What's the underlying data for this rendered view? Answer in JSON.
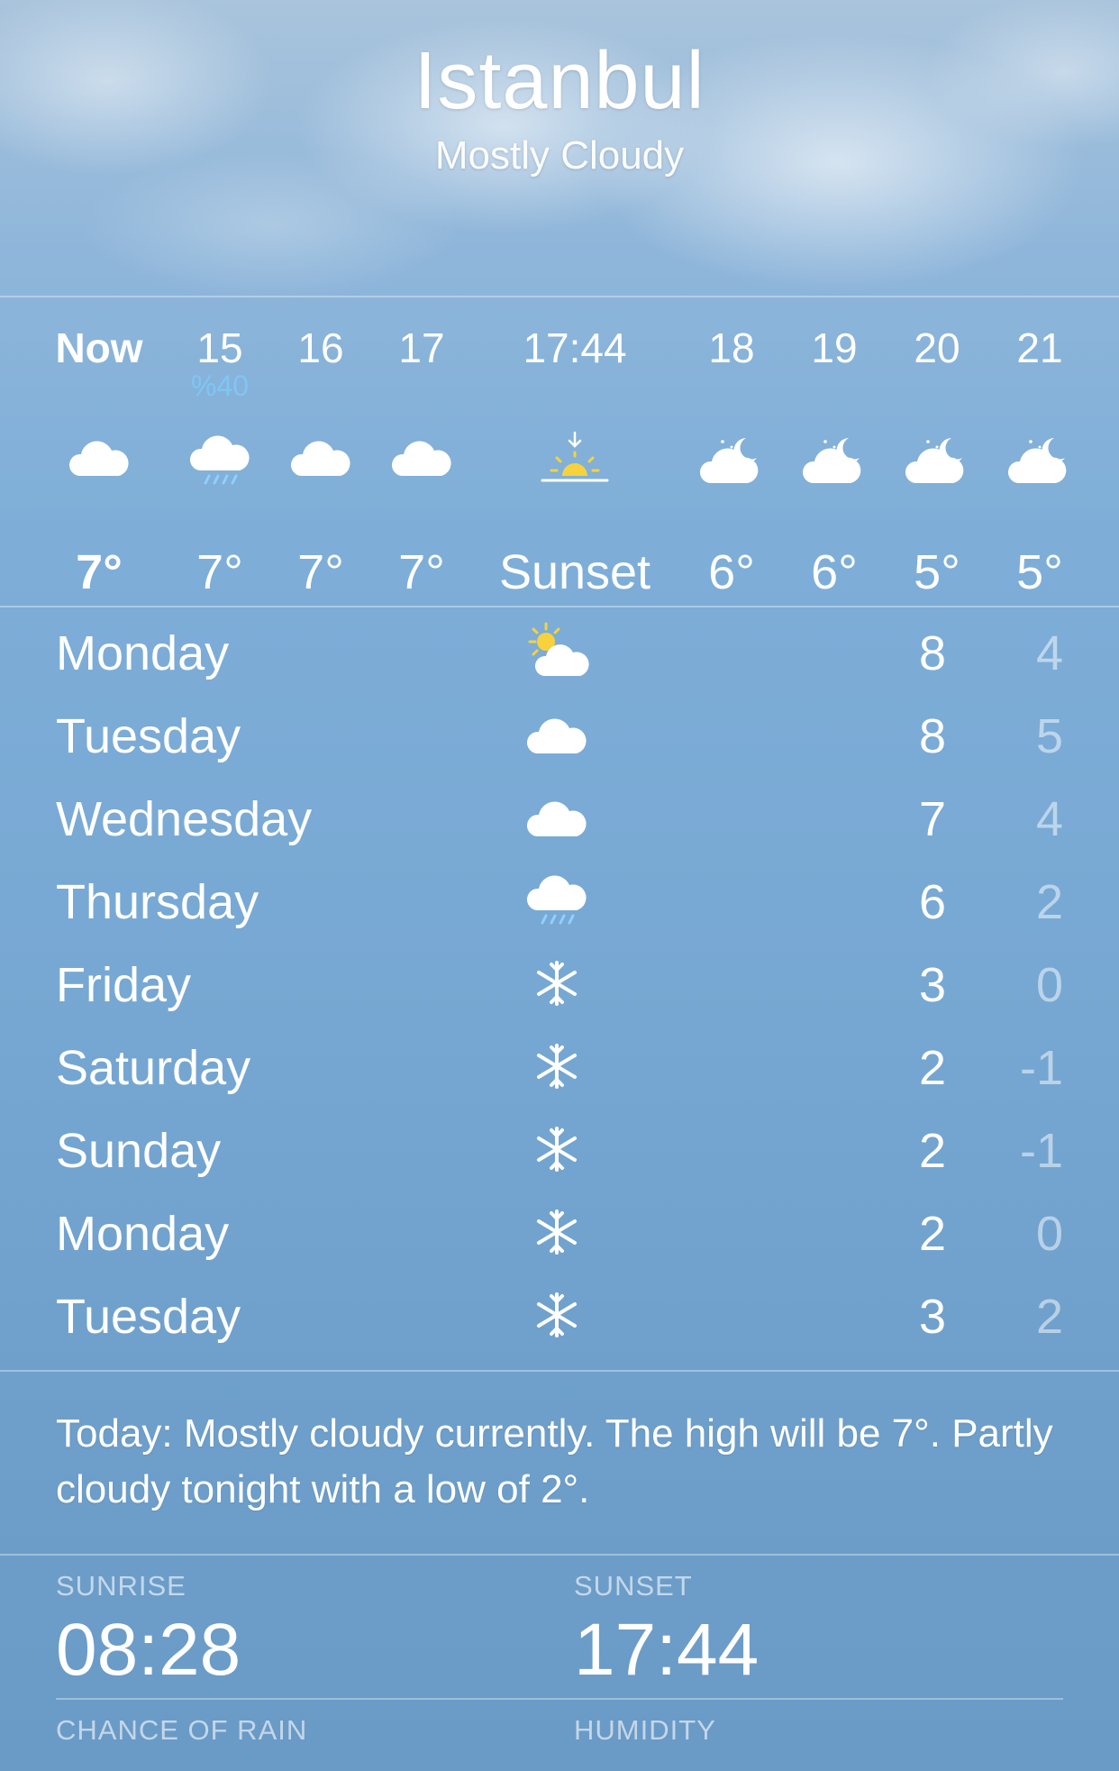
{
  "location": {
    "city": "Istanbul",
    "condition": "Mostly Cloudy"
  },
  "hourly": [
    {
      "time": "Now",
      "icon": "cloud",
      "temp": "7°",
      "bold": true
    },
    {
      "time": "15",
      "precip": "%40",
      "icon": "cloud-rain",
      "temp": "7°"
    },
    {
      "time": "16",
      "icon": "cloud",
      "temp": "7°"
    },
    {
      "time": "17",
      "icon": "cloud",
      "temp": "7°"
    },
    {
      "time": "17:44",
      "icon": "sunset",
      "temp": "Sunset"
    },
    {
      "time": "18",
      "icon": "cloud-moon",
      "temp": "6°"
    },
    {
      "time": "19",
      "icon": "cloud-moon",
      "temp": "6°"
    },
    {
      "time": "20",
      "icon": "cloud-moon",
      "temp": "5°"
    },
    {
      "time": "21",
      "icon": "cloud-moon",
      "temp": "5°"
    }
  ],
  "daily": [
    {
      "day": "Monday",
      "icon": "partly-sunny",
      "high": "8",
      "low": "4"
    },
    {
      "day": "Tuesday",
      "icon": "cloud",
      "high": "8",
      "low": "5"
    },
    {
      "day": "Wednesday",
      "icon": "cloud",
      "high": "7",
      "low": "4"
    },
    {
      "day": "Thursday",
      "icon": "cloud-rain",
      "high": "6",
      "low": "2"
    },
    {
      "day": "Friday",
      "icon": "snowflake",
      "high": "3",
      "low": "0"
    },
    {
      "day": "Saturday",
      "icon": "snowflake",
      "high": "2",
      "low": "-1"
    },
    {
      "day": "Sunday",
      "icon": "snowflake",
      "high": "2",
      "low": "-1"
    },
    {
      "day": "Monday",
      "icon": "snowflake",
      "high": "2",
      "low": "0"
    },
    {
      "day": "Tuesday",
      "icon": "snowflake",
      "high": "3",
      "low": "2"
    }
  ],
  "summary": "Today: Mostly cloudy currently. The high will be 7°. Partly cloudy tonight with a low of 2°.",
  "details": {
    "sunrise": {
      "label": "SUNRISE",
      "value": "08:28"
    },
    "sunset": {
      "label": "SUNSET",
      "value": "17:44"
    },
    "chance_of_rain": {
      "label": "CHANCE OF RAIN"
    },
    "humidity": {
      "label": "HUMIDITY"
    }
  },
  "colors": {
    "precip": "#7fc6f5",
    "sun": "#f7d23c",
    "rain": "#8fd0ff"
  }
}
